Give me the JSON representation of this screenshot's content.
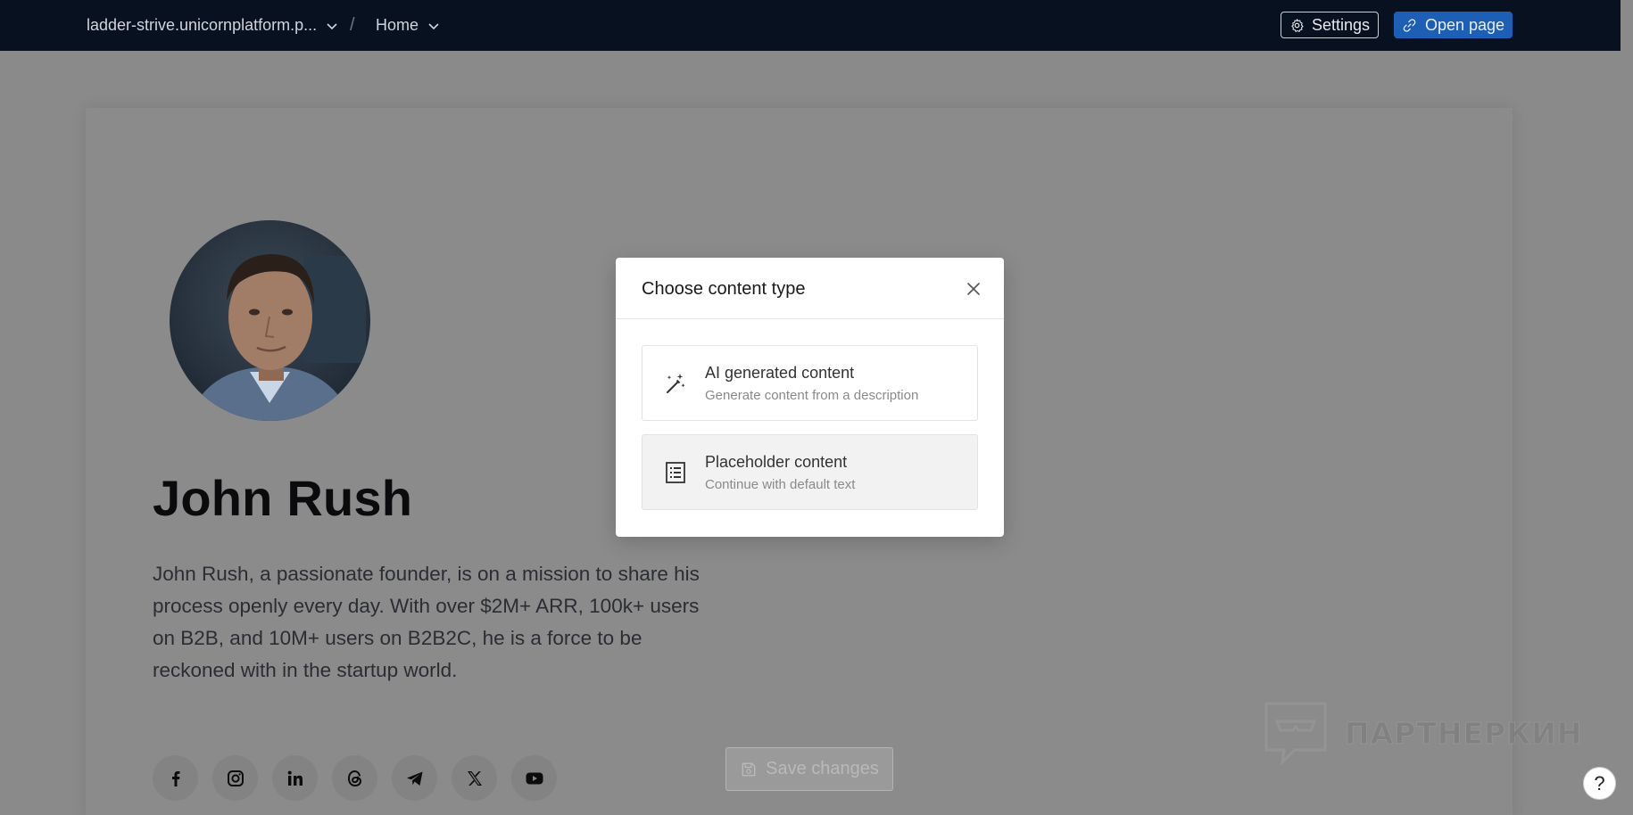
{
  "topbar": {
    "site_name": "ladder-strive.unicornplatform.p...",
    "separator": "/",
    "page_name": "Home",
    "settings_label": "Settings",
    "open_page_label": "Open page"
  },
  "profile": {
    "name": "John Rush",
    "bio": "John Rush, a passionate founder, is on a mission to share his process openly every day. With over $2M+ ARR, 100k+ users on B2B, and 10M+ users on B2B2C, he is a force to be reckoned with in the startup world.",
    "socials": [
      "facebook-icon",
      "instagram-icon",
      "linkedin-icon",
      "threads-icon",
      "telegram-icon",
      "x-icon",
      "youtube-icon"
    ]
  },
  "save_button_label": "Save changes",
  "watermark_text": "ПАРТНЕРКИН",
  "help_label": "?",
  "modal": {
    "title": "Choose content type",
    "options": [
      {
        "title": "AI generated content",
        "subtitle": "Generate content from a description",
        "icon": "magic-wand-icon"
      },
      {
        "title": "Placeholder content",
        "subtitle": "Continue with default text",
        "icon": "list-icon"
      }
    ]
  },
  "colors": {
    "topbar_bg": "#07111f",
    "primary_button": "#1c5fb4",
    "overlay_page": "#8b8b8b",
    "modal_bg": "#ffffff"
  }
}
